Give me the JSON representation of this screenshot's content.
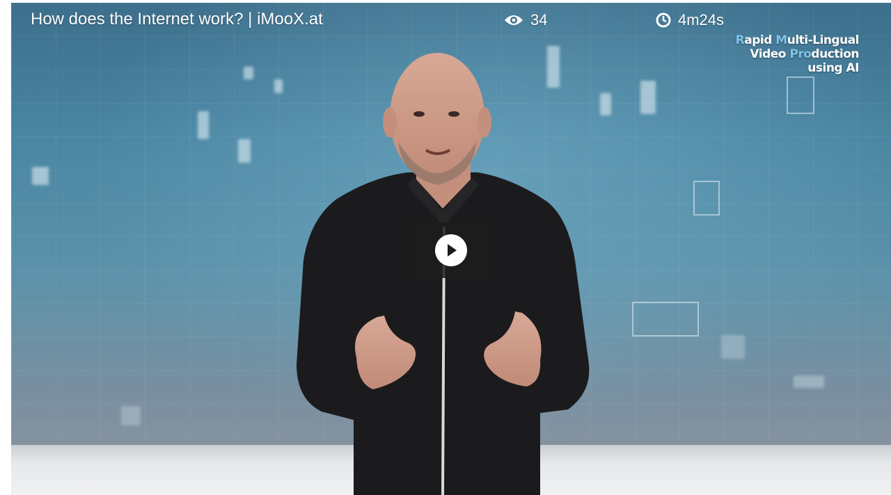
{
  "video": {
    "title": "How does the Internet work? | iMooX.at",
    "views_count": "34",
    "duration": "4m24s",
    "brand_line1_initial1": "R",
    "brand_line1_word1_rest": "apid ",
    "brand_line1_initial2": "M",
    "brand_line1_rest": "ulti-Lingual",
    "brand_line2_a": "Video ",
    "brand_line2_accent": "Pro",
    "brand_line2_b": "duction",
    "brand_line3": "using AI"
  },
  "icons": {
    "views": "eye-icon",
    "duration": "clock-icon",
    "play": "play-icon"
  },
  "colors": {
    "background_top": "#3c6f8c",
    "background_bottom": "#8f96a1",
    "brand_accent": "#7ec3e8",
    "play_button_bg": "#1c1c1c"
  }
}
